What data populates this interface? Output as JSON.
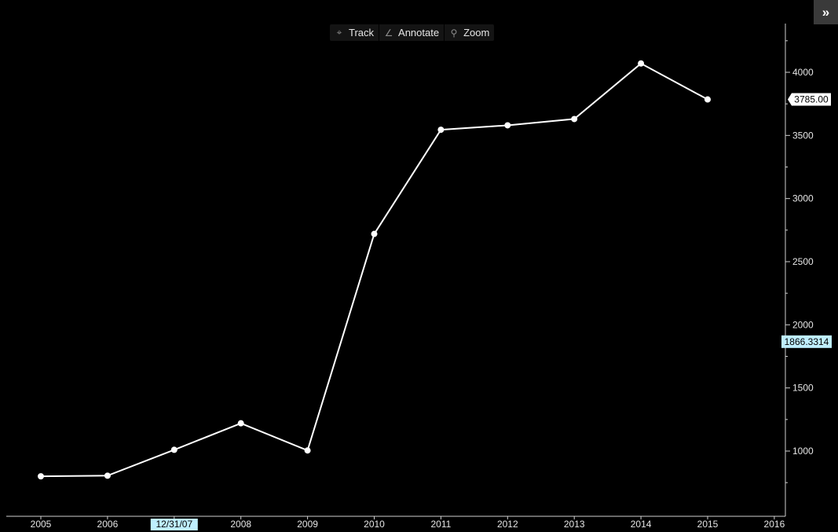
{
  "toolbar": {
    "track_label": "Track",
    "annotate_label": "Annotate",
    "zoom_label": "Zoom",
    "track_icon": "crosshair-icon",
    "annotate_icon": "pencil-icon",
    "zoom_icon": "magnifier-icon"
  },
  "expand_button": {
    "icon": "double-chevron-right-icon",
    "glyph": "»"
  },
  "chart_data": {
    "type": "line",
    "x": [
      2005,
      2006,
      2007,
      2008,
      2009,
      2010,
      2011,
      2012,
      2013,
      2014,
      2015
    ],
    "series": [
      {
        "values": [
          800,
          805,
          1010,
          1220,
          1005,
          2720,
          3545,
          3580,
          3630,
          4070,
          3785
        ]
      }
    ],
    "x_ticks": [
      "2005",
      "2006",
      "2007",
      "2008",
      "2009",
      "2010",
      "2011",
      "2012",
      "2013",
      "2014",
      "2015",
      "2016"
    ],
    "hidden_x_ticks": [
      "2007"
    ],
    "x_cursor_label": "12/31/07",
    "y_ticks": [
      1000,
      1500,
      2000,
      2500,
      3000,
      3500,
      4000
    ],
    "ylim": [
      600,
      4500
    ],
    "last_value_label": "3785.00",
    "crosshair_value": 1866.3314,
    "crosshair_label": "1866.3314",
    "grid": false,
    "colors": {
      "background": "#000000",
      "line": "#ffffff",
      "axis": "#d0d0d0",
      "cursor_flag": "#bfefff",
      "last_flag": "#ffffff"
    }
  }
}
